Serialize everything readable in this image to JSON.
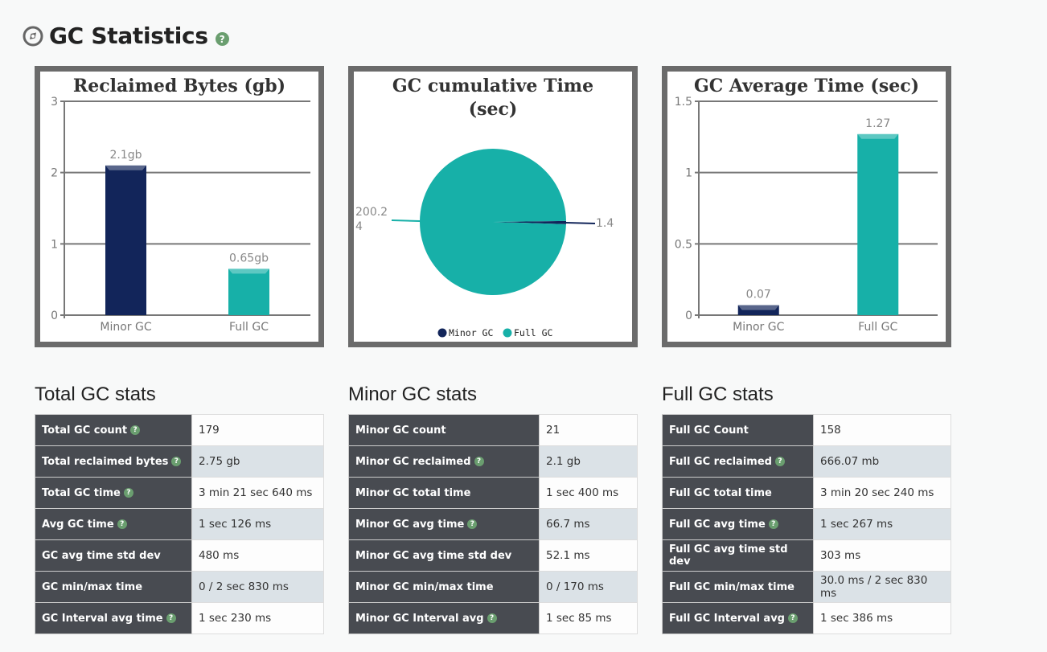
{
  "header": {
    "title": "GC Statistics",
    "title_icon": "compass-icon",
    "help_icon": "question-icon"
  },
  "colors": {
    "minor": "#12255a",
    "full": "#17b0a8",
    "help": "#6a9e6f",
    "key_bg": "#484b51"
  },
  "chart_data": [
    {
      "type": "bar",
      "title": "Reclaimed Bytes (gb)",
      "categories": [
        "Minor GC",
        "Full GC"
      ],
      "values": [
        2.1,
        0.65
      ],
      "data_labels": [
        "2.1gb",
        "0.65gb"
      ],
      "yticks": [
        "0",
        "1",
        "2",
        "3"
      ],
      "ylim": [
        0,
        3
      ],
      "xlabel": "",
      "ylabel": "",
      "grid": true
    },
    {
      "type": "pie",
      "title": "GC cumulative Time (sec)",
      "categories": [
        "Minor GC",
        "Full GC"
      ],
      "values": [
        1.4,
        200.24
      ],
      "data_labels": [
        "1.4",
        "200.24"
      ],
      "legend": [
        "Minor GC",
        "Full GC"
      ],
      "legend_position": "bottom"
    },
    {
      "type": "bar",
      "title": "GC Average Time (sec)",
      "categories": [
        "Minor GC",
        "Full GC"
      ],
      "values": [
        0.07,
        1.27
      ],
      "data_labels": [
        "0.07",
        "1.27"
      ],
      "yticks": [
        "0",
        "0.5",
        "1",
        "1.5"
      ],
      "ylim": [
        0,
        1.5
      ],
      "xlabel": "",
      "ylabel": "",
      "grid": true
    }
  ],
  "sections": [
    {
      "title": "Total GC stats",
      "rows": [
        {
          "label": "Total GC count",
          "help": true,
          "value": "179"
        },
        {
          "label": "Total reclaimed bytes",
          "help": true,
          "value": "2.75 gb"
        },
        {
          "label": "Total GC time",
          "help": true,
          "value": "3 min 21 sec 640 ms"
        },
        {
          "label": "Avg GC time",
          "help": true,
          "value": "1 sec 126 ms"
        },
        {
          "label": "GC avg time std dev",
          "help": false,
          "value": "480 ms"
        },
        {
          "label": "GC min/max time",
          "help": false,
          "value": "0 / 2 sec 830 ms"
        },
        {
          "label": "GC Interval avg time",
          "help": true,
          "value": "1 sec 230 ms"
        }
      ]
    },
    {
      "title": "Minor GC stats",
      "rows": [
        {
          "label": "Minor GC count",
          "help": false,
          "value": "21"
        },
        {
          "label": "Minor GC reclaimed",
          "help": true,
          "value": "2.1 gb"
        },
        {
          "label": "Minor GC total time",
          "help": false,
          "value": "1 sec 400 ms"
        },
        {
          "label": "Minor GC avg time",
          "help": true,
          "value": "66.7 ms"
        },
        {
          "label": "Minor GC avg time std dev",
          "help": false,
          "value": "52.1 ms"
        },
        {
          "label": "Minor GC min/max time",
          "help": false,
          "value": "0 / 170 ms"
        },
        {
          "label": "Minor GC Interval avg",
          "help": true,
          "value": "1 sec 85 ms"
        }
      ]
    },
    {
      "title": "Full GC stats",
      "rows": [
        {
          "label": "Full GC Count",
          "help": false,
          "value": "158"
        },
        {
          "label": "Full GC reclaimed",
          "help": true,
          "value": "666.07 mb"
        },
        {
          "label": "Full GC total time",
          "help": false,
          "value": "3 min 20 sec 240 ms"
        },
        {
          "label": "Full GC avg time",
          "help": true,
          "value": "1 sec 267 ms"
        },
        {
          "label": "Full GC avg time std dev",
          "help": false,
          "value": "303 ms"
        },
        {
          "label": "Full GC min/max time",
          "help": false,
          "value": "30.0 ms / 2 sec 830 ms"
        },
        {
          "label": "Full GC Interval avg",
          "help": true,
          "value": "1 sec 386 ms"
        }
      ]
    }
  ]
}
